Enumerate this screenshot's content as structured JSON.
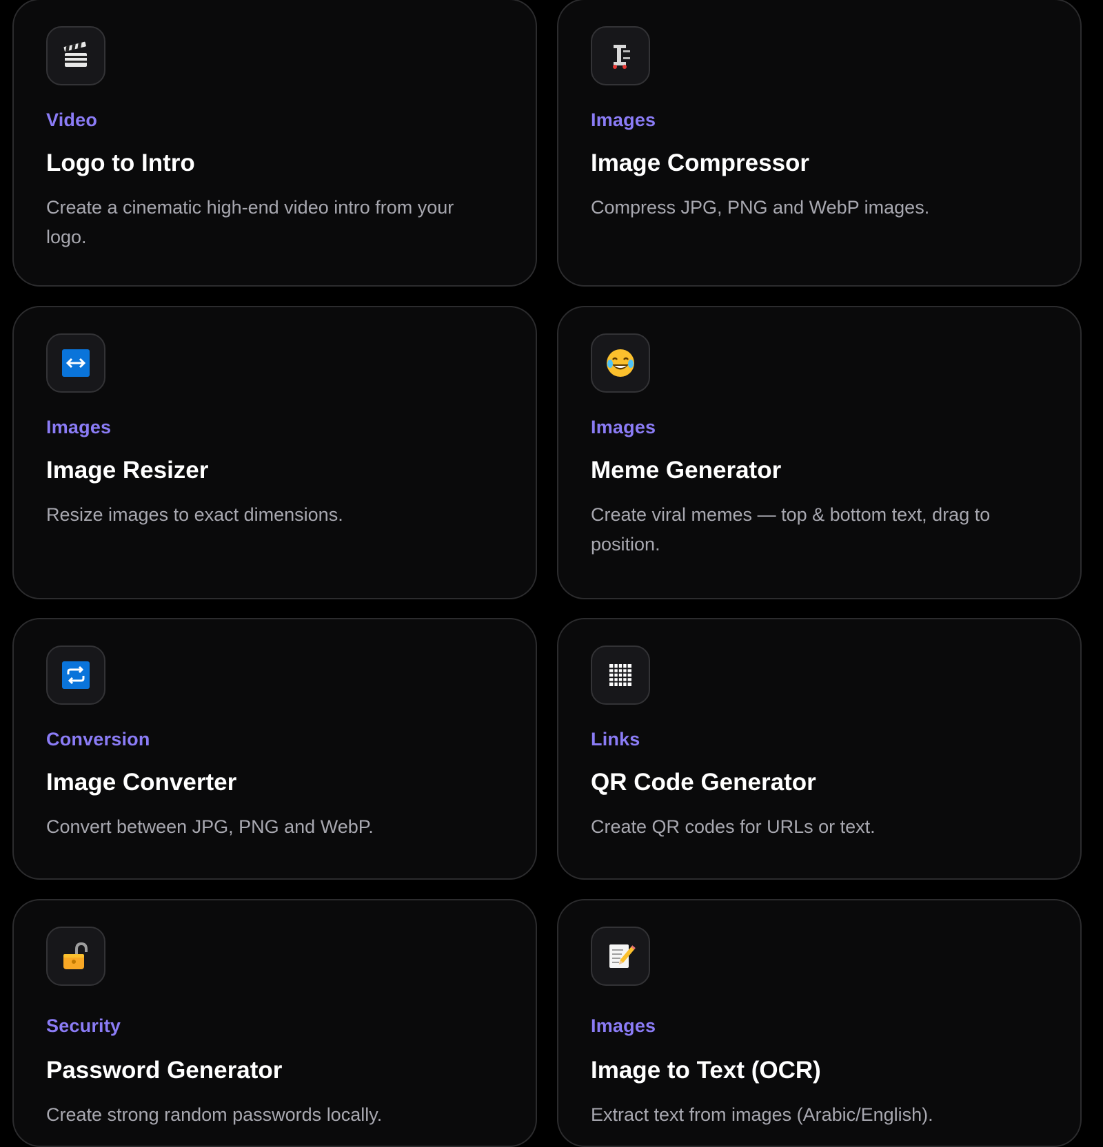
{
  "tools": [
    {
      "category": "Video",
      "title": "Logo to Intro",
      "description": "Create a cinematic high-end video intro from your logo.",
      "icon": "clapperboard-icon"
    },
    {
      "category": "Images",
      "title": "Image Compressor",
      "description": "Compress JPG, PNG and WebP images.",
      "icon": "clamp-icon"
    },
    {
      "category": "Images",
      "title": "Image Resizer",
      "description": "Resize images to exact dimensions.",
      "icon": "left-right-arrow-icon"
    },
    {
      "category": "Images",
      "title": "Meme Generator",
      "description": "Create viral memes — top & bottom text, drag to position.",
      "icon": "tears-of-joy-icon"
    },
    {
      "category": "Conversion",
      "title": "Image Converter",
      "description": "Convert between JPG, PNG and WebP.",
      "icon": "repeat-arrows-icon"
    },
    {
      "category": "Links",
      "title": "QR Code Generator",
      "description": "Create QR codes for URLs or text.",
      "icon": "grid-icon"
    },
    {
      "category": "Security",
      "title": "Password Generator",
      "description": "Create strong random passwords locally.",
      "icon": "unlocked-padlock-icon"
    },
    {
      "category": "Images",
      "title": "Image to Text (OCR)",
      "description": "Extract text from images (Arabic/English).",
      "icon": "memo-icon"
    }
  ],
  "colors": {
    "background": "#000000",
    "card": "#0a0a0b",
    "card_border": "#2c2c2e",
    "category": "#8b7cf6",
    "title": "#ffffff",
    "description": "#a8a8b0",
    "icon_blue": "#0a74da"
  }
}
